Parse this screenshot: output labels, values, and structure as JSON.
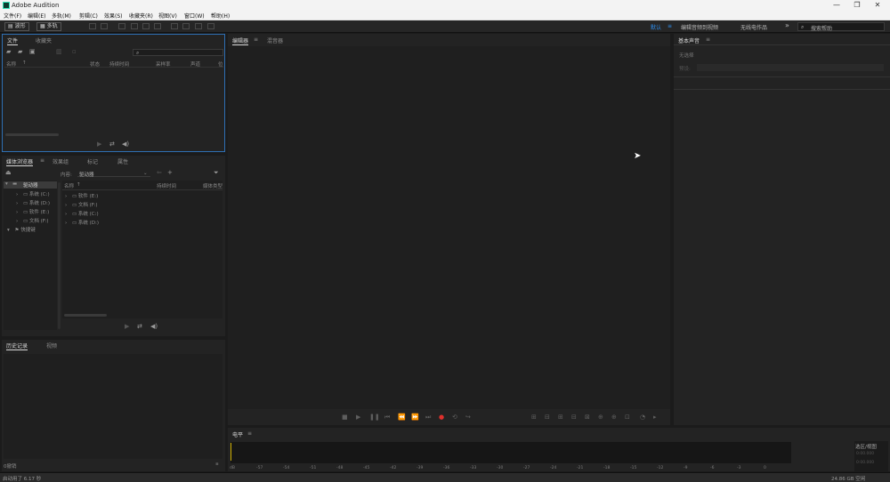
{
  "window": {
    "title": "Adobe Audition",
    "minimize": "—",
    "maximize": "❐",
    "close": "✕"
  },
  "menu": [
    "文件(F)",
    "编辑(E)",
    "多轨(M)",
    "剪辑(C)",
    "效果(S)",
    "收藏夹(R)",
    "视图(V)",
    "窗口(W)",
    "帮助(H)"
  ],
  "toolbar": {
    "waveform": "波形",
    "multitrack": "多轨",
    "workspaces": [
      "默认",
      "编辑音频到视频",
      "无线电作品"
    ],
    "active_workspace": "默认",
    "menu_icon": "≡",
    "overflow": "»",
    "search_placeholder": "搜索帮助"
  },
  "files_panel": {
    "tabs": [
      "文件",
      "收藏夹"
    ],
    "columns": [
      "名称",
      "状态",
      "持续时间",
      "采样率",
      "声道",
      "位"
    ],
    "sort_marker": "↑",
    "search_icon": "⌕"
  },
  "media_panel": {
    "tabs": [
      "媒体浏览器",
      "效果组",
      "标记",
      "属性"
    ],
    "content_label": "内容:",
    "content_value": "驱动器",
    "tree": [
      {
        "label": "驱动器",
        "level": 0,
        "expanded": true
      },
      {
        "label": "系统 (C:)",
        "level": 1
      },
      {
        "label": "系统 (D:)",
        "level": 1
      },
      {
        "label": "软件 (E:)",
        "level": 1
      },
      {
        "label": "文档 (F:)",
        "level": 1
      },
      {
        "label": "快捷键",
        "level": 0,
        "expanded": true
      }
    ],
    "columns": [
      "名称",
      "持续时间",
      "媒体类型"
    ],
    "sort_marker": "↑",
    "items": [
      "软件 (E:)",
      "文档 (F:)",
      "系统 (C:)",
      "系统 (D:)"
    ]
  },
  "history_panel": {
    "tabs": [
      "历史记录",
      "视频"
    ],
    "footer": "0撤销"
  },
  "editor_panel": {
    "tabs": [
      "编辑器",
      "混音器"
    ]
  },
  "level_panel": {
    "title": "电平",
    "ticks": [
      "dB",
      "-57",
      "-54",
      "-51",
      "-48",
      "-45",
      "-42",
      "-39",
      "-36",
      "-33",
      "-30",
      "-27",
      "-24",
      "-21",
      "-18",
      "-15",
      "-12",
      "-9",
      "-6",
      "-3",
      "0"
    ]
  },
  "essential_sound": {
    "title": "基本声音",
    "no_selection": "无选择",
    "preset_label": "预设:"
  },
  "selection_panel": {
    "title": "选区/视图",
    "time_a": "0:00.000",
    "time_b": "0:00.000"
  },
  "status": {
    "left": "启动用了 6.17 秒",
    "right": "24.86 GB 空闲"
  },
  "colors": {
    "accent": "#2d8ceb",
    "record": "#e0302c",
    "panel": "#232323",
    "background": "#1b1b1b"
  }
}
